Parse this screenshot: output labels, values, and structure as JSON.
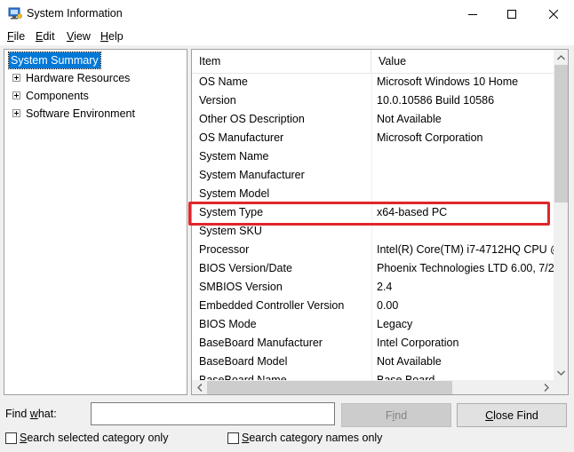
{
  "window": {
    "title": "System Information",
    "app_icon": "system-information-icon"
  },
  "menu": [
    {
      "label": "File",
      "accel": "F",
      "rest": "ile"
    },
    {
      "label": "Edit",
      "accel": "E",
      "rest": "dit"
    },
    {
      "label": "View",
      "accel": "V",
      "rest": "iew"
    },
    {
      "label": "Help",
      "accel": "H",
      "rest": "elp"
    }
  ],
  "tree": {
    "root": "System Summary",
    "children": [
      "Hardware Resources",
      "Components",
      "Software Environment"
    ]
  },
  "list": {
    "columns": {
      "item": "Item",
      "value": "Value"
    },
    "rows": [
      {
        "item": "OS Name",
        "value": "Microsoft Windows 10 Home"
      },
      {
        "item": "Version",
        "value": "10.0.10586 Build 10586"
      },
      {
        "item": "Other OS Description",
        "value": "Not Available"
      },
      {
        "item": "OS Manufacturer",
        "value": "Microsoft Corporation"
      },
      {
        "item": "System Name",
        "value": ""
      },
      {
        "item": "System Manufacturer",
        "value": ""
      },
      {
        "item": "System Model",
        "value": ""
      },
      {
        "item": "System Type",
        "value": "x64-based PC"
      },
      {
        "item": "System SKU",
        "value": ""
      },
      {
        "item": "Processor",
        "value": "Intel(R) Core(TM) i7-4712HQ CPU @"
      },
      {
        "item": "BIOS Version/Date",
        "value": "Phoenix Technologies LTD 6.00, 7/2"
      },
      {
        "item": "SMBIOS Version",
        "value": "2.4"
      },
      {
        "item": "Embedded Controller Version",
        "value": "0.00"
      },
      {
        "item": "BIOS Mode",
        "value": "Legacy"
      },
      {
        "item": "BaseBoard Manufacturer",
        "value": "Intel Corporation"
      },
      {
        "item": "BaseBoard Model",
        "value": "Not Available"
      },
      {
        "item": "BaseBoard Name",
        "value": "Base Board"
      }
    ],
    "highlighted_row": "System Type",
    "highlight_color": "#e0262d"
  },
  "find": {
    "label_accel": "w",
    "label_pre": "Find ",
    "label_post": "hat:",
    "value": "",
    "find_button": {
      "accel": "i",
      "pre": "F",
      "post": "nd"
    },
    "close_button": {
      "accel": "C",
      "pre": "",
      "post": "lose Find"
    },
    "check_selected": {
      "accel": "S",
      "pre": "",
      "post": "earch selected category only",
      "checked": false
    },
    "check_names": {
      "accel": "S",
      "pre": "",
      "post": "earch category names only",
      "checked": false
    }
  },
  "colors": {
    "selection": "#0078d7",
    "highlight_border": "#e0262d"
  }
}
